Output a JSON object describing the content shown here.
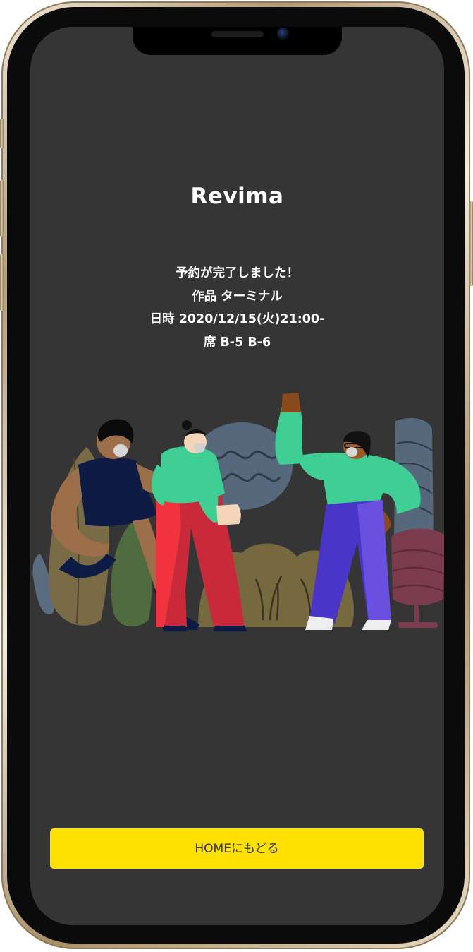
{
  "app": {
    "title": "Revima"
  },
  "reservation": {
    "message": "予約が完了しました！",
    "work": "作品 ターミナル",
    "datetime": "日時 2020/12/15(火)21:00-",
    "seats": "席 B-5 B-6"
  },
  "actions": {
    "home_label": "HOMEにもどる"
  },
  "colors": {
    "screen_background": "#353535",
    "button_background": "#ffe000",
    "button_text": "#333333",
    "text": "#ffffff"
  }
}
